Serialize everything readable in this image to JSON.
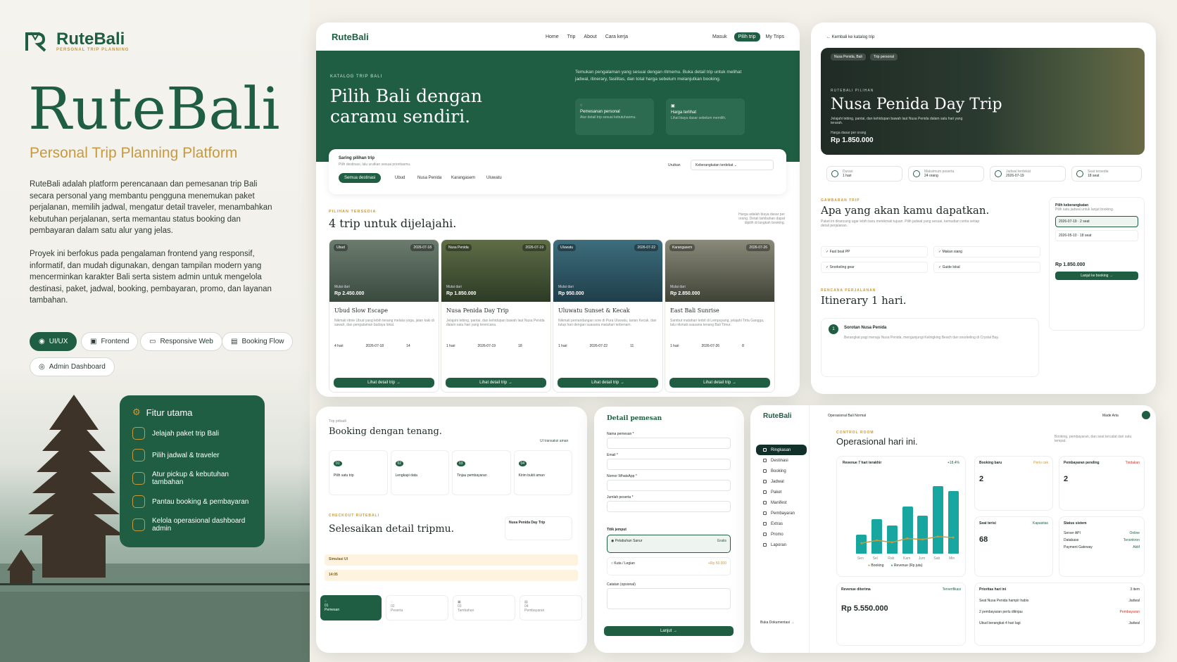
{
  "brand": {
    "name": "RuteBali",
    "tag": "PERSONAL TRIP PLANNING"
  },
  "hero": {
    "title": "RuteBali",
    "subtitle": "Personal Trip Planning Platform",
    "p1": "RuteBali adalah platform perencanaan dan pemesanan trip Bali secara personal yang membantu pengguna menemukan paket perjalanan, memilih jadwal, mengatur detail traveler, menambahkan kebutuhan perjalanan, serta memantau status booking dan pembayaran dalam satu alur yang jelas.",
    "p2": "Proyek ini berfokus pada pengalaman frontend yang responsif, informatif, dan mudah digunakan, dengan tampilan modern yang mencerminkan karakter Bali serta sistem admin untuk mengelola destinasi, paket, jadwal, booking, pembayaran, promo, dan layanan tambahan.",
    "chips": [
      "UI/UX",
      "Frontend",
      "Responsive Web",
      "Booking Flow",
      "Admin Dashboard"
    ]
  },
  "features": {
    "title": "Fitur utama",
    "items": [
      "Jelajah paket trip Bali",
      "Pilih jadwal & traveler",
      "Atur pickup & kebutuhan tambahan",
      "Pantau booking & pembayaran",
      "Kelola operasional dashboard admin"
    ]
  },
  "catalog": {
    "nav": [
      "Home",
      "Trip",
      "About",
      "Cara kerja"
    ],
    "masuk": "Masuk",
    "pilih": "Pilih trip",
    "mytrips": "My Trips",
    "eyebrow": "KATALOG TRIP BALI",
    "headline1": "Pilih Bali dengan",
    "headline2": "caramu sendiri.",
    "intro": "Temukan pengalaman yang sesuai dengan ritmemu. Buka detail trip untuk melihat jadwal, itinerary, fasilitas, dan total harga sebelum melanjutkan booking.",
    "box1": {
      "t": "Pemesanan personal",
      "d": "Atur detail trip sesuai kebutuhanmu."
    },
    "box2": {
      "t": "Harga terlihat",
      "d": "Lihat biaya dasar sebelum memilih."
    },
    "filter_title": "Saring pilihan trip",
    "filter_sub": "Pilih destinasi, lalu urutkan sesuai prioritasmu.",
    "filters": [
      "Semua destinasi",
      "Ubud",
      "Nusa Penida",
      "Karangasem",
      "Uluwatu"
    ],
    "sort_label": "Urutkan",
    "sort_val": "Keberangkatan terdekat",
    "avail_label": "PILIHAN TERSEDIA",
    "avail_title": "4 trip untuk dijelajahi.",
    "avail_note": "Harga adalah biaya dasar per orang. Detail tambahan dapat dipilih di langkah booking.",
    "from": "Mulai dari",
    "per": "/ orang",
    "btn": "Lihat detail trip →",
    "trips": [
      {
        "tag": "Ubud",
        "date": "2026-07-18",
        "price": "Rp 2.450.000",
        "name": "Ubud Slow Escape",
        "desc": "Nikmati ritme Ubud yang lebih tenang melalui yoga, jalan kaki di sawah, dan pengalaman budaya lokal.",
        "dur": "4 hari",
        "d2": "2026-07-18",
        "seat": "14"
      },
      {
        "tag": "Nusa Penida",
        "date": "2026-07-19",
        "price": "Rp 1.850.000",
        "name": "Nusa Penida Day Trip",
        "desc": "Jelajahi tebing, pantai, dan kehidupan bawah laut Nusa Penida dalam satu hari yang terencana.",
        "dur": "1 hari",
        "d2": "2026-07-19",
        "seat": "18"
      },
      {
        "tag": "Uluwatu",
        "date": "2026-07-22",
        "price": "Rp 950.000",
        "name": "Uluwatu Sunset & Kecak",
        "desc": "Nikmati pemandangan sore di Pura Uluwatu, tarian Kecak, dan tutup hari dengan suasana matahari terbenam.",
        "dur": "1 hari",
        "d2": "2026-07-22",
        "seat": "11"
      },
      {
        "tag": "Karangasem",
        "date": "2026-07-26",
        "price": "Rp 2.850.000",
        "name": "East Bali Sunrise",
        "desc": "Sambut matahari terbit di Lempuyang, jelajahi Tirta Gangga, lalu nikmati suasana tenang Bali Timur.",
        "dur": "1 hari",
        "d2": "2026-07-26",
        "seat": "8"
      }
    ]
  },
  "detail": {
    "back": "← Kembali ke katalog trip",
    "tags": [
      "Nusa Penida, Bali",
      "Trip personal"
    ],
    "eyebrow": "RUTEBALI PILIHAN",
    "title": "Nusa Penida Day Trip",
    "desc": "Jelajahi tebing, pantai, dan kehidupan bawah laut Nusa Penida dalam satu hari yang terarah.",
    "price_label": "Harga dasar per orang",
    "price": "Rp 1.850.000",
    "stats": [
      {
        "l": "Durasi",
        "v": "1 hari"
      },
      {
        "l": "Maksimum peserta",
        "v": "24 orang"
      },
      {
        "l": "Jadwal terdekat",
        "v": "2026-07-19"
      },
      {
        "l": "Seat tersedia",
        "v": "18 seat"
      }
    ],
    "get_eyebrow": "GAMBARAN TRIP",
    "get_title": "Apa yang akan kamu dapatkan.",
    "get_desc": "Paket ini dirancang agar lebih baru menikmati tujuan. Pilih jadwal yang sesuai, kemudian cerita setiap detail perjalanan.",
    "facilities": [
      "Fast boat PP",
      "Makan siang",
      "Snorkeling gear",
      "Guide lokal"
    ],
    "itin_eyebrow": "RENCANA PERJALANAN",
    "itin_title": "Itinerary 1 hari.",
    "itin_item": "Sorotan Nusa Penida",
    "itin_desc": "Berangkat pagi menuju Nusa Penida, mengunjungi Kelingking Beach dan snorkeling di Crystal Bay.",
    "side_title": "Pilih keberangkatan",
    "side_sub": "Pilih satu jadwal untuk lanjut booking.",
    "dates": [
      {
        "d": "2026-07-19",
        "s": "2 seat"
      },
      {
        "d": "2026-05-10",
        "s": "18 seat"
      }
    ],
    "side_price": "Rp 1.850.000",
    "side_btn": "Lanjut ke booking →"
  },
  "booking": {
    "eyebrow": "Trip pribadi",
    "title": "Booking dengan tenang.",
    "secure": "UI transaksi aman",
    "steps": [
      {
        "n": "01",
        "t": "Pilih satu trip"
      },
      {
        "n": "02",
        "t": "Lengkapi data"
      },
      {
        "n": "03",
        "t": "Tinjau pembayaran"
      },
      {
        "n": "04",
        "t": "Kirim bukti aman"
      }
    ],
    "checkout_eyebrow": "CHECKOUT RUTEBALI",
    "checkout_title": "Selesaikan detail tripmu.",
    "summary_trip": "Nusa Penida Day Trip",
    "warn1": "Simulasi UI",
    "warn2": "14:05",
    "tabs": [
      "Pemesan",
      "Peserta",
      "Tambahan",
      "Pembayaran"
    ]
  },
  "form": {
    "title": "Detail pemesan",
    "fields": [
      "Nama pemesan *",
      "Email *",
      "Nomor WhatsApp *",
      "Jumlah peserta *"
    ],
    "pickup_label": "Titik jemput",
    "pickup1": "Pelabuhan Sanur",
    "pickup1_tag": "Gratis",
    "pickup2": "Kuta / Legian",
    "pickup2_tag": "+Rp 50.000",
    "notes": "Catatan (opsional)",
    "btn": "Lanjut →"
  },
  "admin": {
    "brand": "RuteBali",
    "crumb": "Operasional Bali Normal",
    "user": "Made Arta",
    "nav": [
      "Ringkasan",
      "Destinasi",
      "Booking",
      "Jadwal",
      "Paket",
      "Manifest",
      "Pembayaran",
      "Extras",
      "Promo",
      "Laporan"
    ],
    "eyebrow": "CONTROL ROOM",
    "title": "Operasional hari ini.",
    "desc": "Booking, pembayaran, dan seat tercatat dari satu tempat.",
    "chart": {
      "title": "Revenue 7 hari terakhir",
      "badge": "+18,4%",
      "legend": [
        "Booking",
        "Revenue (Rp juta)"
      ]
    },
    "booking_baru": {
      "t": "Booking baru",
      "v": "2",
      "tag": "Perlu cek"
    },
    "pembayaran": {
      "t": "Pembayaran pending",
      "v": "2",
      "tag": "Tindakan"
    },
    "seat": {
      "t": "Seat terisi",
      "v": "68",
      "tag": "Kapasitas"
    },
    "status": {
      "t": "Status sistem",
      "rows": [
        "Server API",
        "Database",
        "Payment Gateway"
      ],
      "tags": [
        "Online",
        "Tersinkron",
        "Aktif"
      ]
    },
    "revenue": {
      "t": "Revenue diterima",
      "v": "Rp 5.550.000",
      "tag": "Terverifikasi"
    },
    "prioritas": {
      "t": "Prioritas hari ini",
      "tag": "3 item",
      "rows": [
        "Seat Nusa Penida hampir habis",
        "2 pembayaran perlu ditinjau",
        "Ubud berangkat 4 hari lagi"
      ],
      "rtags": [
        "Jadwal",
        "Pembayaran",
        "Jadwal"
      ]
    },
    "help": "Buka Dokumentasi →"
  },
  "chart_data": {
    "type": "bar",
    "categories": [
      "Sen",
      "Sel",
      "Rab",
      "Kam",
      "Jum",
      "Sab",
      "Min"
    ],
    "series": [
      {
        "name": "Revenue (Rp juta)",
        "values": [
          2.0,
          3.6,
          3.0,
          5.0,
          4.0,
          7.1,
          6.6
        ]
      },
      {
        "name": "Booking",
        "values": [
          1.1,
          1.4,
          1.2,
          1.6,
          1.5,
          1.8,
          1.7
        ]
      }
    ],
    "title": "Revenue 7 hari terakhir",
    "xlabel": "",
    "ylabel": "",
    "ylim": [
      0,
      8
    ]
  },
  "colors": {
    "primary": "#1f5e42",
    "accent": "#c79a3c",
    "teal": "#17a7a0"
  }
}
